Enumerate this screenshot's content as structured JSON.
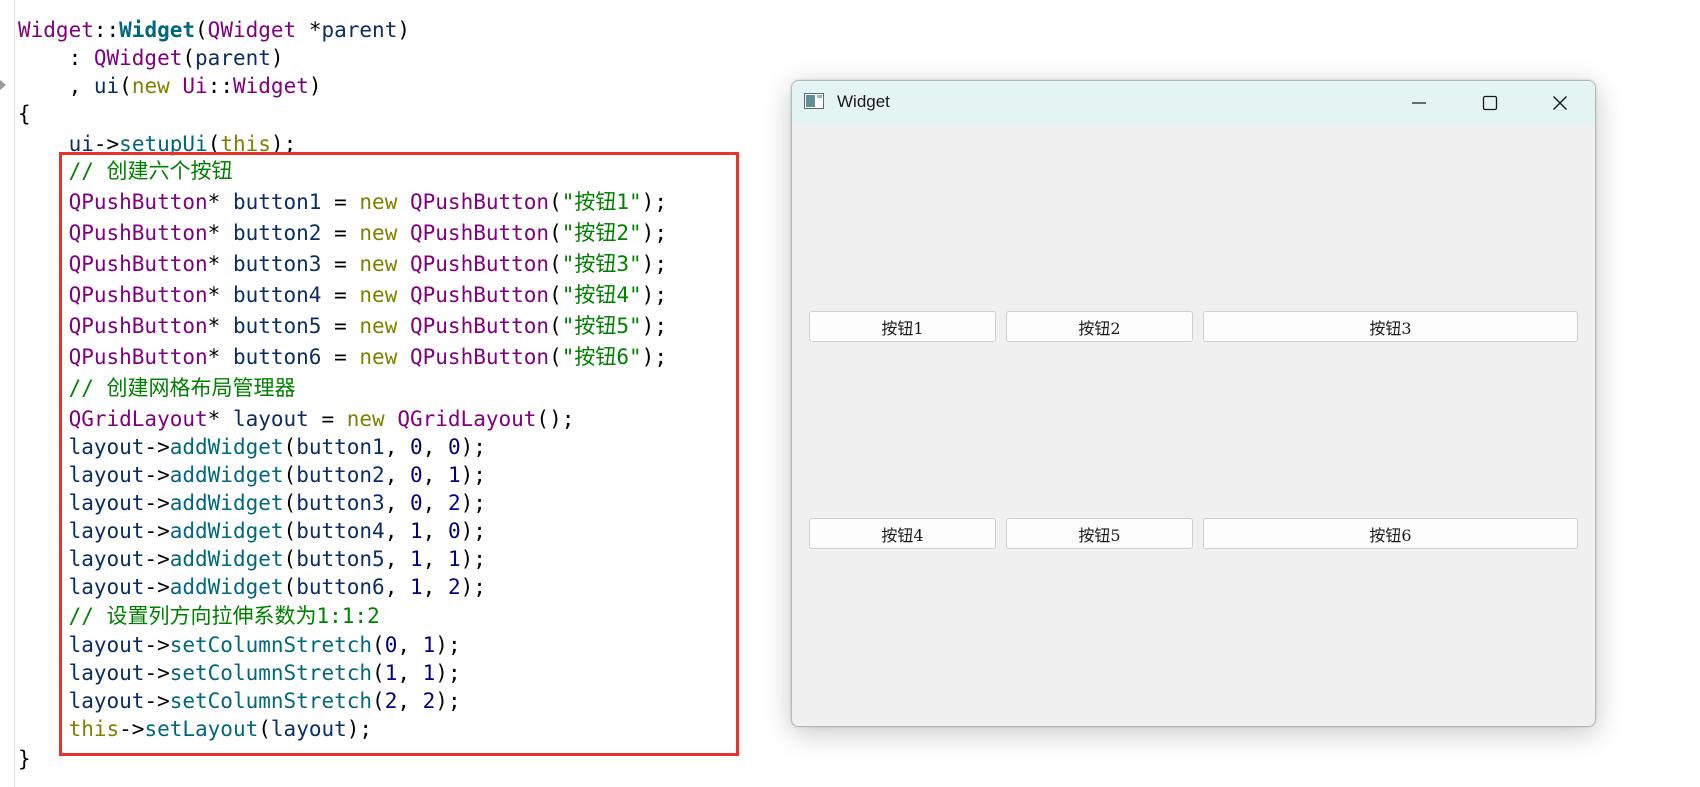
{
  "editor": {
    "lines": [
      [
        [
          "c-type",
          "Widget"
        ],
        [
          "c-plain",
          "::"
        ],
        [
          "c-funcb",
          "Widget"
        ],
        [
          "c-plain",
          "("
        ],
        [
          "c-type",
          "QWidget"
        ],
        [
          "c-plain",
          " *"
        ],
        [
          "c-var",
          "parent"
        ],
        [
          "c-plain",
          ")"
        ]
      ],
      [
        [
          "c-plain",
          "    : "
        ],
        [
          "c-type",
          "QWidget"
        ],
        [
          "c-plain",
          "("
        ],
        [
          "c-var",
          "parent"
        ],
        [
          "c-plain",
          ")"
        ]
      ],
      [
        [
          "c-plain",
          "    , "
        ],
        [
          "c-var",
          "ui"
        ],
        [
          "c-plain",
          "("
        ],
        [
          "c-kw",
          "new"
        ],
        [
          "c-plain",
          " "
        ],
        [
          "c-type",
          "Ui"
        ],
        [
          "c-plain",
          "::"
        ],
        [
          "c-type",
          "Widget"
        ],
        [
          "c-plain",
          ")"
        ]
      ],
      [
        [
          "c-plain",
          "{"
        ]
      ],
      [
        [
          "c-plain",
          "    "
        ],
        [
          "c-var",
          "ui"
        ],
        [
          "c-plain",
          "->"
        ],
        [
          "c-func",
          "setupUi"
        ],
        [
          "c-plain",
          "("
        ],
        [
          "c-kw",
          "this"
        ],
        [
          "c-plain",
          ");"
        ]
      ],
      [
        [
          "c-plain",
          "    "
        ],
        [
          "c-cmt",
          "// 创建六个按钮"
        ]
      ],
      [
        [
          "c-plain",
          "    "
        ],
        [
          "c-type",
          "QPushButton"
        ],
        [
          "c-plain",
          "* "
        ],
        [
          "c-var",
          "button1"
        ],
        [
          "c-plain",
          " = "
        ],
        [
          "c-kw",
          "new"
        ],
        [
          "c-plain",
          " "
        ],
        [
          "c-type",
          "QPushButton"
        ],
        [
          "c-plain",
          "("
        ],
        [
          "c-str",
          "\"按钮1\""
        ],
        [
          "c-plain",
          ");"
        ]
      ],
      [
        [
          "c-plain",
          "    "
        ],
        [
          "c-type",
          "QPushButton"
        ],
        [
          "c-plain",
          "* "
        ],
        [
          "c-var",
          "button2"
        ],
        [
          "c-plain",
          " = "
        ],
        [
          "c-kw",
          "new"
        ],
        [
          "c-plain",
          " "
        ],
        [
          "c-type",
          "QPushButton"
        ],
        [
          "c-plain",
          "("
        ],
        [
          "c-str",
          "\"按钮2\""
        ],
        [
          "c-plain",
          ");"
        ]
      ],
      [
        [
          "c-plain",
          "    "
        ],
        [
          "c-type",
          "QPushButton"
        ],
        [
          "c-plain",
          "* "
        ],
        [
          "c-var",
          "button3"
        ],
        [
          "c-plain",
          " = "
        ],
        [
          "c-kw",
          "new"
        ],
        [
          "c-plain",
          " "
        ],
        [
          "c-type",
          "QPushButton"
        ],
        [
          "c-plain",
          "("
        ],
        [
          "c-str",
          "\"按钮3\""
        ],
        [
          "c-plain",
          ");"
        ]
      ],
      [
        [
          "c-plain",
          "    "
        ],
        [
          "c-type",
          "QPushButton"
        ],
        [
          "c-plain",
          "* "
        ],
        [
          "c-var",
          "button4"
        ],
        [
          "c-plain",
          " = "
        ],
        [
          "c-kw",
          "new"
        ],
        [
          "c-plain",
          " "
        ],
        [
          "c-type",
          "QPushButton"
        ],
        [
          "c-plain",
          "("
        ],
        [
          "c-str",
          "\"按钮4\""
        ],
        [
          "c-plain",
          ");"
        ]
      ],
      [
        [
          "c-plain",
          "    "
        ],
        [
          "c-type",
          "QPushButton"
        ],
        [
          "c-plain",
          "* "
        ],
        [
          "c-var",
          "button5"
        ],
        [
          "c-plain",
          " = "
        ],
        [
          "c-kw",
          "new"
        ],
        [
          "c-plain",
          " "
        ],
        [
          "c-type",
          "QPushButton"
        ],
        [
          "c-plain",
          "("
        ],
        [
          "c-str",
          "\"按钮5\""
        ],
        [
          "c-plain",
          ");"
        ]
      ],
      [
        [
          "c-plain",
          "    "
        ],
        [
          "c-type",
          "QPushButton"
        ],
        [
          "c-plain",
          "* "
        ],
        [
          "c-var",
          "button6"
        ],
        [
          "c-plain",
          " = "
        ],
        [
          "c-kw",
          "new"
        ],
        [
          "c-plain",
          " "
        ],
        [
          "c-type",
          "QPushButton"
        ],
        [
          "c-plain",
          "("
        ],
        [
          "c-str",
          "\"按钮6\""
        ],
        [
          "c-plain",
          ");"
        ]
      ],
      [
        [
          "c-plain",
          "    "
        ],
        [
          "c-cmt",
          "// 创建网格布局管理器"
        ]
      ],
      [
        [
          "c-plain",
          "    "
        ],
        [
          "c-type",
          "QGridLayout"
        ],
        [
          "c-plain",
          "* "
        ],
        [
          "c-var",
          "layout"
        ],
        [
          "c-plain",
          " = "
        ],
        [
          "c-kw",
          "new"
        ],
        [
          "c-plain",
          " "
        ],
        [
          "c-type",
          "QGridLayout"
        ],
        [
          "c-plain",
          "();"
        ]
      ],
      [
        [
          "c-plain",
          "    "
        ],
        [
          "c-var",
          "layout"
        ],
        [
          "c-plain",
          "->"
        ],
        [
          "c-func",
          "addWidget"
        ],
        [
          "c-plain",
          "("
        ],
        [
          "c-var",
          "button1"
        ],
        [
          "c-plain",
          ", "
        ],
        [
          "c-num",
          "0"
        ],
        [
          "c-plain",
          ", "
        ],
        [
          "c-num",
          "0"
        ],
        [
          "c-plain",
          ");"
        ]
      ],
      [
        [
          "c-plain",
          "    "
        ],
        [
          "c-var",
          "layout"
        ],
        [
          "c-plain",
          "->"
        ],
        [
          "c-func",
          "addWidget"
        ],
        [
          "c-plain",
          "("
        ],
        [
          "c-var",
          "button2"
        ],
        [
          "c-plain",
          ", "
        ],
        [
          "c-num",
          "0"
        ],
        [
          "c-plain",
          ", "
        ],
        [
          "c-num",
          "1"
        ],
        [
          "c-plain",
          ");"
        ]
      ],
      [
        [
          "c-plain",
          "    "
        ],
        [
          "c-var",
          "layout"
        ],
        [
          "c-plain",
          "->"
        ],
        [
          "c-func",
          "addWidget"
        ],
        [
          "c-plain",
          "("
        ],
        [
          "c-var",
          "button3"
        ],
        [
          "c-plain",
          ", "
        ],
        [
          "c-num",
          "0"
        ],
        [
          "c-plain",
          ", "
        ],
        [
          "c-num",
          "2"
        ],
        [
          "c-plain",
          ");"
        ]
      ],
      [
        [
          "c-plain",
          "    "
        ],
        [
          "c-var",
          "layout"
        ],
        [
          "c-plain",
          "->"
        ],
        [
          "c-func",
          "addWidget"
        ],
        [
          "c-plain",
          "("
        ],
        [
          "c-var",
          "button4"
        ],
        [
          "c-plain",
          ", "
        ],
        [
          "c-num",
          "1"
        ],
        [
          "c-plain",
          ", "
        ],
        [
          "c-num",
          "0"
        ],
        [
          "c-plain",
          ");"
        ]
      ],
      [
        [
          "c-plain",
          "    "
        ],
        [
          "c-var",
          "layout"
        ],
        [
          "c-plain",
          "->"
        ],
        [
          "c-func",
          "addWidget"
        ],
        [
          "c-plain",
          "("
        ],
        [
          "c-var",
          "button5"
        ],
        [
          "c-plain",
          ", "
        ],
        [
          "c-num",
          "1"
        ],
        [
          "c-plain",
          ", "
        ],
        [
          "c-num",
          "1"
        ],
        [
          "c-plain",
          ");"
        ]
      ],
      [
        [
          "c-plain",
          "    "
        ],
        [
          "c-var",
          "layout"
        ],
        [
          "c-plain",
          "->"
        ],
        [
          "c-func",
          "addWidget"
        ],
        [
          "c-plain",
          "("
        ],
        [
          "c-var",
          "button6"
        ],
        [
          "c-plain",
          ", "
        ],
        [
          "c-num",
          "1"
        ],
        [
          "c-plain",
          ", "
        ],
        [
          "c-num",
          "2"
        ],
        [
          "c-plain",
          ");"
        ]
      ],
      [
        [
          "c-plain",
          "    "
        ],
        [
          "c-cmt",
          "// 设置列方向拉伸系数为1:1:2"
        ]
      ],
      [
        [
          "c-plain",
          "    "
        ],
        [
          "c-var",
          "layout"
        ],
        [
          "c-plain",
          "->"
        ],
        [
          "c-func",
          "setColumnStretch"
        ],
        [
          "c-plain",
          "("
        ],
        [
          "c-num",
          "0"
        ],
        [
          "c-plain",
          ", "
        ],
        [
          "c-num",
          "1"
        ],
        [
          "c-plain",
          ");"
        ]
      ],
      [
        [
          "c-plain",
          "    "
        ],
        [
          "c-var",
          "layout"
        ],
        [
          "c-plain",
          "->"
        ],
        [
          "c-func",
          "setColumnStretch"
        ],
        [
          "c-plain",
          "("
        ],
        [
          "c-num",
          "1"
        ],
        [
          "c-plain",
          ", "
        ],
        [
          "c-num",
          "1"
        ],
        [
          "c-plain",
          ");"
        ]
      ],
      [
        [
          "c-plain",
          "    "
        ],
        [
          "c-var",
          "layout"
        ],
        [
          "c-plain",
          "->"
        ],
        [
          "c-func",
          "setColumnStretch"
        ],
        [
          "c-plain",
          "("
        ],
        [
          "c-num",
          "2"
        ],
        [
          "c-plain",
          ", "
        ],
        [
          "c-num",
          "2"
        ],
        [
          "c-plain",
          ");"
        ]
      ],
      [
        [
          "c-plain",
          "    "
        ],
        [
          "c-kw",
          "this"
        ],
        [
          "c-plain",
          "->"
        ],
        [
          "c-func",
          "setLayout"
        ],
        [
          "c-plain",
          "("
        ],
        [
          "c-var",
          "layout"
        ],
        [
          "c-plain",
          ");"
        ]
      ],
      [
        [
          "c-plain",
          "}"
        ]
      ]
    ]
  },
  "window": {
    "title": "Widget",
    "icons": {
      "app": "window-app-icon",
      "minimize": "minimize-icon",
      "maximize": "maximize-icon",
      "close": "close-icon"
    },
    "buttons": [
      {
        "label": "按钮1",
        "row": 0,
        "col": 0
      },
      {
        "label": "按钮2",
        "row": 0,
        "col": 1
      },
      {
        "label": "按钮3",
        "row": 0,
        "col": 2
      },
      {
        "label": "按钮4",
        "row": 1,
        "col": 0
      },
      {
        "label": "按钮5",
        "row": 1,
        "col": 1
      },
      {
        "label": "按钮6",
        "row": 1,
        "col": 2
      }
    ],
    "column_stretch": [
      1,
      1,
      2
    ]
  },
  "colors": {
    "highlight_border": "#e8322b",
    "titlebar": "#e3f4f2",
    "window_bg": "#f0f0f0"
  }
}
